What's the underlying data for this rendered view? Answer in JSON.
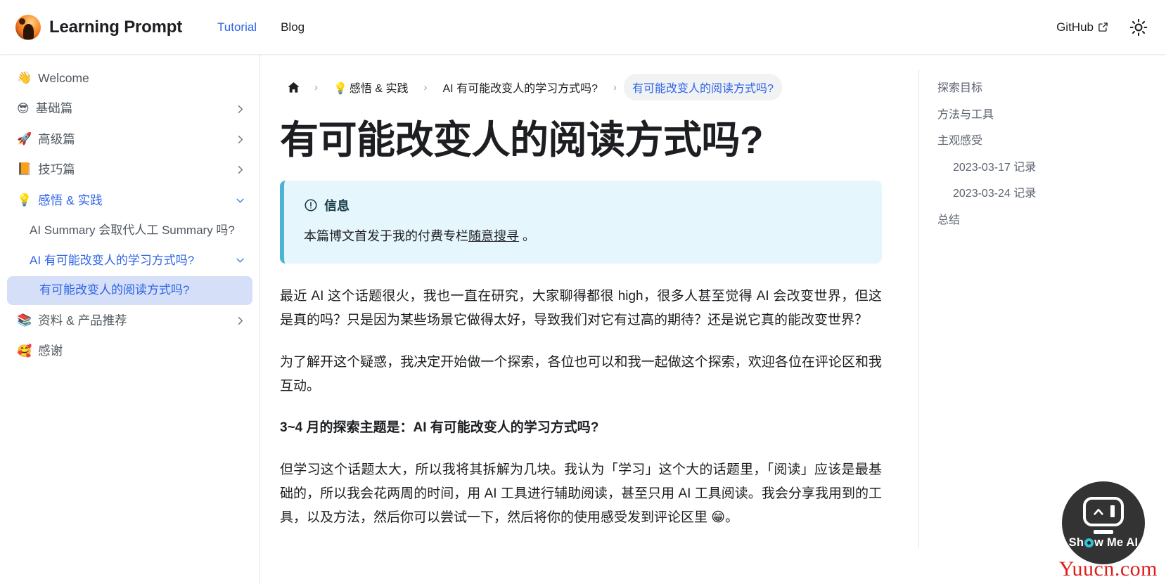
{
  "navbar": {
    "brand_title": "Learning Prompt",
    "brand_logo_icon": "avatar-logo",
    "links": [
      {
        "label": "Tutorial",
        "active": true
      },
      {
        "label": "Blog",
        "active": false
      }
    ],
    "github_label": "GitHub",
    "github_icon": "external-link-icon",
    "theme_toggle_icon": "sun-icon"
  },
  "sidebar": {
    "items": [
      {
        "emoji": "👋",
        "label": "Welcome",
        "icon_name": "waving-hand-icon",
        "caret": "none",
        "state": "normal",
        "indent": 0
      },
      {
        "emoji": "😎",
        "label": "基础篇",
        "icon_name": "sunglasses-face-icon",
        "caret": "right",
        "state": "normal",
        "indent": 0
      },
      {
        "emoji": "🚀",
        "label": "高级篇",
        "icon_name": "rocket-icon",
        "caret": "right",
        "state": "normal",
        "indent": 0
      },
      {
        "emoji": "📙",
        "label": "技巧篇",
        "icon_name": "orange-book-icon",
        "caret": "right",
        "state": "normal",
        "indent": 0
      },
      {
        "emoji": "💡",
        "label": "感悟 & 实践",
        "icon_name": "light-bulb-icon",
        "caret": "down",
        "state": "blue",
        "indent": 0
      },
      {
        "emoji": "",
        "label": "AI Summary 会取代人工 Summary 吗?",
        "icon_name": "",
        "caret": "none",
        "state": "normal",
        "indent": 1
      },
      {
        "emoji": "",
        "label": "AI 有可能改变人的学习方式吗?",
        "icon_name": "",
        "caret": "down",
        "state": "blue",
        "indent": 1
      },
      {
        "emoji": "",
        "label": "有可能改变人的阅读方式吗?",
        "icon_name": "",
        "caret": "none",
        "state": "selected",
        "indent": 2
      },
      {
        "emoji": "📚",
        "label": "资料 & 产品推荐",
        "icon_name": "books-icon",
        "caret": "right",
        "state": "normal",
        "indent": 0
      },
      {
        "emoji": "🥰",
        "label": "感谢",
        "icon_name": "smiling-face-with-hearts-icon",
        "caret": "none",
        "state": "normal",
        "indent": 0
      }
    ]
  },
  "breadcrumbs": [
    {
      "label": "",
      "emoji": "",
      "icon_name": "home-icon",
      "type": "home"
    },
    {
      "label": "感悟 & 实践",
      "emoji": "💡",
      "icon_name": "light-bulb-icon",
      "type": "link"
    },
    {
      "label": "AI 有可能改变人的学习方式吗?",
      "emoji": "",
      "icon_name": "",
      "type": "link"
    },
    {
      "label": "有可能改变人的阅读方式吗?",
      "emoji": "",
      "icon_name": "",
      "type": "current"
    }
  ],
  "article": {
    "title": "有可能改变人的阅读方式吗?",
    "admonition": {
      "icon_name": "info-circle-icon",
      "title": "信息",
      "body_before": "本篇博文首发于我的付费专栏",
      "link_text": "随意搜寻",
      "body_after": " 。"
    },
    "paragraphs": [
      {
        "text": "最近 AI 这个话题很火，我也一直在研究，大家聊得都很 high，很多人甚至觉得 AI 会改变世界，但这是真的吗？只是因为某些场景它做得太好，导致我们对它有过高的期待？还是说它真的能改变世界？",
        "bold": false
      },
      {
        "text": "为了解开这个疑惑，我决定开始做一个探索，各位也可以和我一起做这个探索，欢迎各位在评论区和我互动。",
        "bold": false
      },
      {
        "text": "3~4 月的探索主题是：AI 有可能改变人的学习方式吗?",
        "bold": true
      },
      {
        "text": "但学习这个话题太大，所以我将其拆解为几块。我认为「学习」这个大的话题里，「阅读」应该是最基础的，所以我会花两周的时间，用 AI 工具进行辅助阅读，甚至只用 AI 工具阅读。我会分享我用到的工具，以及方法，然后你可以尝试一下，然后将你的使用感受发到评论区里 😁。",
        "bold": false
      }
    ]
  },
  "toc": {
    "items": [
      {
        "label": "探索目标",
        "indent": 0
      },
      {
        "label": "方法与工具",
        "indent": 0
      },
      {
        "label": "主观感受",
        "indent": 0
      },
      {
        "label": "2023-03-17 记录",
        "indent": 1
      },
      {
        "label": "2023-03-24 记录",
        "indent": 1
      },
      {
        "label": "总结",
        "indent": 0
      }
    ]
  },
  "fab": {
    "label_part1": "Sh",
    "label_part2": "w Me AI",
    "icon_name": "robot-monitor-icon"
  },
  "watermark": {
    "text": "Yuucn.com"
  },
  "colors": {
    "accent_blue": "#2e63e8",
    "text": "#1c1e21",
    "muted": "#525860",
    "admonition_bg": "#e6f6fd",
    "admonition_border": "#4cb3d4",
    "selected_bg": "#d5dff7",
    "pill_bg": "#f1f2f3",
    "fab_bg": "#333333",
    "watermark_red": "#e01b1b"
  }
}
